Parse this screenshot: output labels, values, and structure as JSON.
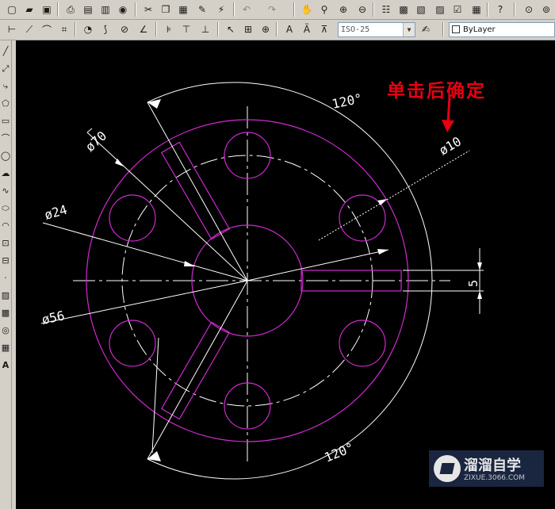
{
  "toolbar_top": {
    "icons": [
      "new-icon",
      "open-icon",
      "save-icon",
      "print-icon",
      "preview-icon",
      "plot-icon",
      "publish-icon",
      "cut-icon",
      "copy-icon",
      "paste-icon",
      "match-properties-icon",
      "block-editor-icon",
      "undo-icon",
      "redo-icon",
      "pan-icon",
      "zoom-realtime-icon",
      "zoom-window-icon",
      "zoom-previous-icon",
      "properties-icon",
      "design-center-icon",
      "tool-palettes-icon",
      "sheet-set-icon",
      "markup-icon",
      "calculator-icon",
      "help-icon"
    ]
  },
  "toolbar_dim": {
    "dimstyle": "ISO-25",
    "layer": "ByLayer"
  },
  "drawing": {
    "labels": {
      "angle_top": "120°",
      "angle_bottom": "120°",
      "dia70": "ø70",
      "dia24": "ø24",
      "dia56": "ø56",
      "dia10": "ø10",
      "width5": "5"
    },
    "colors": {
      "geometry": "#d02ad0",
      "dimensions": "#ffffff",
      "background": "#000000"
    }
  },
  "annotation": {
    "text": "单击后确定"
  },
  "watermark": {
    "title": "溜溜自学",
    "url": "ZIXUE.3066.COM"
  }
}
